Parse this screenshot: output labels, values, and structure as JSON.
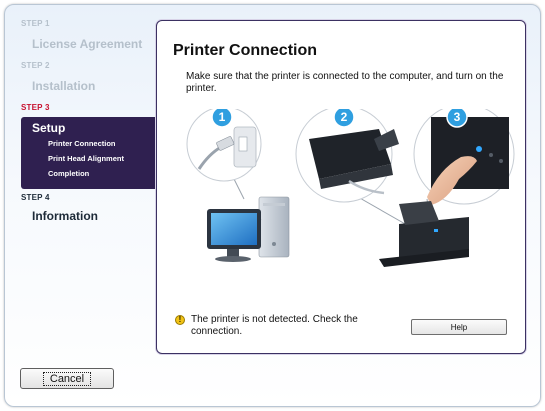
{
  "sidebar": {
    "step1_label": "STEP 1",
    "step1_item": "License Agreement",
    "step2_label": "STEP 2",
    "step2_item": "Installation",
    "step3_label": "STEP 3",
    "step3_item": "Setup",
    "step3_subitems": [
      "Printer Connection",
      "Print Head Alignment",
      "Completion"
    ],
    "step4_label": "STEP 4",
    "step4_item": "Information"
  },
  "panel": {
    "title": "Printer Connection",
    "description": "Make sure that the printer is connected to the computer, and turn on the printer.",
    "steps": [
      "1",
      "2",
      "3"
    ],
    "status_message": "The printer is not detected. Check the connection.",
    "status_icon": "exclamation-icon",
    "help_label": "Help"
  },
  "footer": {
    "cancel_label": "Cancel"
  },
  "colors": {
    "active_step": "#c8102e",
    "setup_highlight": "#2f2050",
    "badge_blue": "#2f9fe0",
    "panel_border": "#3b3162"
  }
}
